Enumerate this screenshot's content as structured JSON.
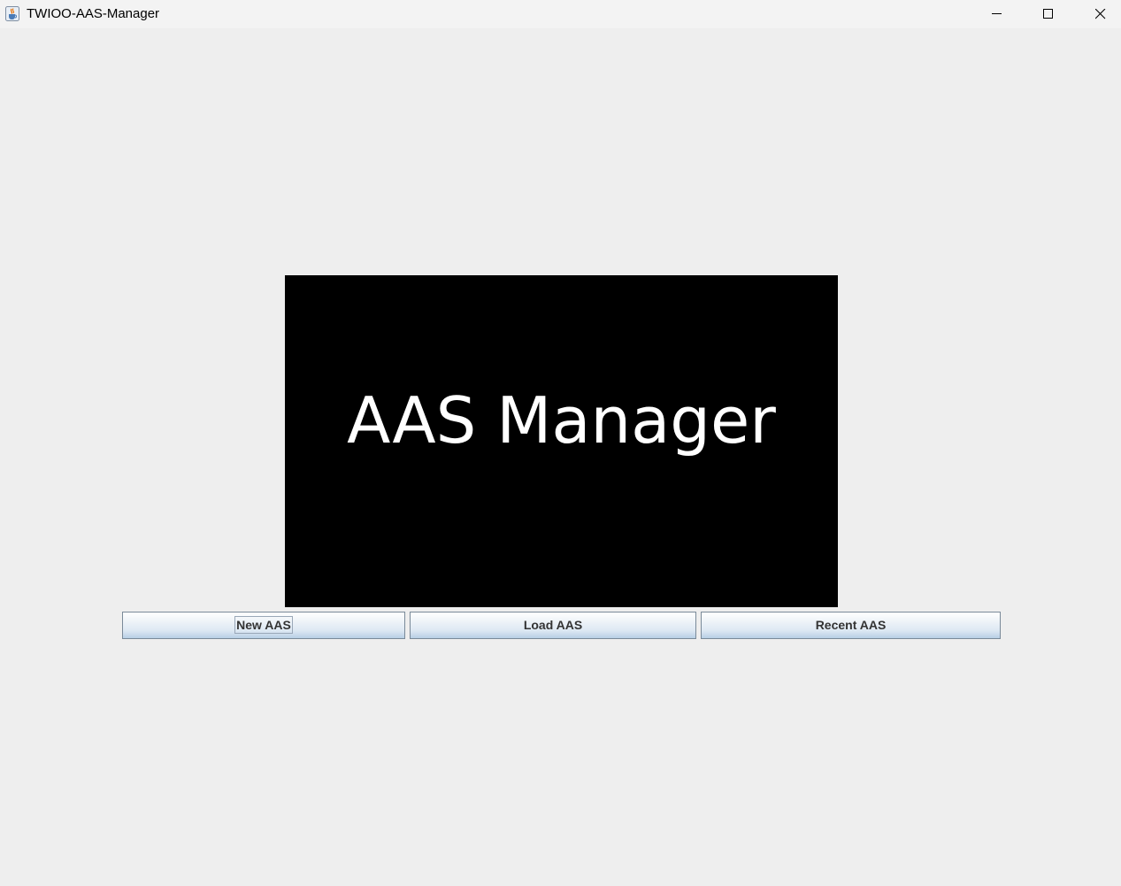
{
  "window": {
    "title": "TWIOO-AAS-Manager",
    "icon": "java-cup-icon"
  },
  "logo": {
    "text": "AAS Manager",
    "background": "#000000",
    "text_color": "#ffffff"
  },
  "buttons": {
    "new_label": "New AAS",
    "load_label": "Load AAS",
    "recent_label": "Recent AAS",
    "focused": "New AAS"
  },
  "controls": {
    "minimize": "minimize-icon",
    "maximize": "maximize-icon",
    "close": "close-icon"
  }
}
